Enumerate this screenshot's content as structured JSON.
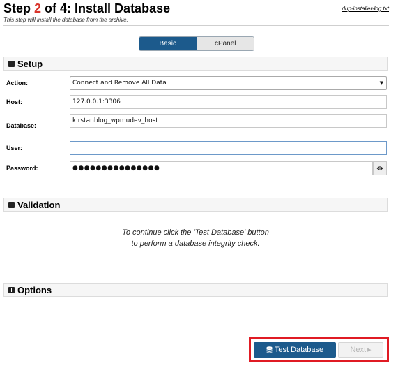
{
  "header": {
    "title_prefix": "Step ",
    "step_current": "2",
    "title_mid": " of ",
    "step_total": "4",
    "title_suffix": ": Install Database",
    "subtitle": "This step will install the database from the archive.",
    "log_link": "dup-installer-log.txt"
  },
  "mode_tabs": [
    {
      "label": "Basic",
      "active": true
    },
    {
      "label": "cPanel",
      "active": false
    }
  ],
  "sections": {
    "setup": "Setup",
    "validation": "Validation",
    "options": "Options"
  },
  "form": {
    "action_label": "Action:",
    "action_value": "Connect and Remove All Data",
    "host_label": "Host:",
    "host_value": "127.0.0.1:3306",
    "database_label": "Database:",
    "database_value": "kirstanblog_wpmudev_host",
    "user_label": "User:",
    "user_value": "",
    "password_label": "Password:",
    "password_value": "●●●●●●●●●●●●●●●"
  },
  "validation": {
    "line1": "To continue click the 'Test Database' button",
    "line2": "to perform a database integrity check."
  },
  "buttons": {
    "test_database": "Test Database",
    "next": "Next"
  },
  "icons": {
    "select_arrow": "caret-down-icon",
    "eye": "eye-icon",
    "database": "database-icon",
    "next_arrow": "caret-right-icon"
  },
  "colors": {
    "accent": "#1c5a8c",
    "step_number": "#d9342b",
    "highlight_box": "#e01b24"
  }
}
